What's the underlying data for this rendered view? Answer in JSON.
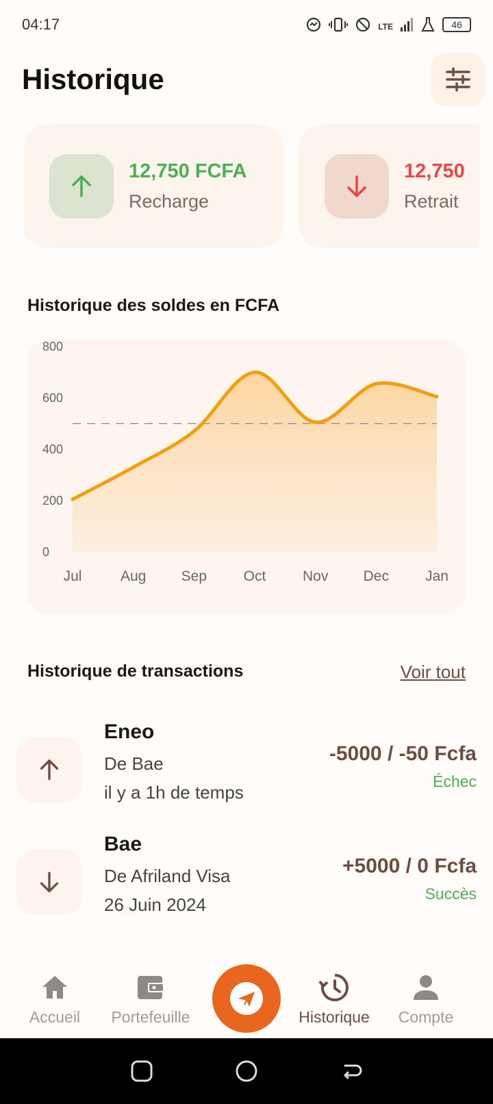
{
  "status_bar": {
    "time": "04:17",
    "network": "LTE",
    "battery": "46"
  },
  "header": {
    "title": "Historique"
  },
  "summary_cards": [
    {
      "amount": "12,750 FCFA",
      "label": "Recharge",
      "direction": "up",
      "color": "#4caf50"
    },
    {
      "amount": "12,750",
      "label": "Retrait",
      "direction": "down",
      "color": "#ef4444"
    }
  ],
  "chart_section": {
    "title": "Historique des soldes en FCFA"
  },
  "chart_data": {
    "type": "area",
    "x": [
      "Jul",
      "Aug",
      "Sep",
      "Oct",
      "Nov",
      "Dec",
      "Jan"
    ],
    "values": [
      205,
      330,
      470,
      700,
      505,
      655,
      605
    ],
    "yticks": [
      "800",
      "600",
      "400",
      "200",
      "0"
    ],
    "ylim": [
      0,
      800
    ],
    "reference_line": 500,
    "line_color": "#f59e0b",
    "fill_color": "#fdd8a0"
  },
  "transactions_section": {
    "title": "Historique de transactions",
    "see_all": "Voir tout"
  },
  "transactions": [
    {
      "name": "Eneo",
      "from": "De Bae",
      "date": "il y a 1h de temps",
      "amount": "-5000 / -50 Fcfa",
      "status": "Échec",
      "direction": "up"
    },
    {
      "name": "Bae",
      "from": "De Afriland Visa",
      "date": "26 Juin 2024",
      "amount": "+5000 / 0 Fcfa",
      "status": "Succès",
      "direction": "down"
    }
  ],
  "bottom_nav": {
    "items": [
      {
        "label": "Accueil",
        "icon": "home-icon"
      },
      {
        "label": "Portefeuille",
        "icon": "wallet-icon"
      },
      {
        "label": "",
        "icon": "send-icon"
      },
      {
        "label": "Historique",
        "icon": "history-icon"
      },
      {
        "label": "Compte",
        "icon": "person-icon"
      }
    ],
    "active": "Historique"
  },
  "colors": {
    "accent": "#e8661d",
    "brown": "#6d4c41",
    "success": "#4caf50",
    "danger": "#ef4444"
  }
}
